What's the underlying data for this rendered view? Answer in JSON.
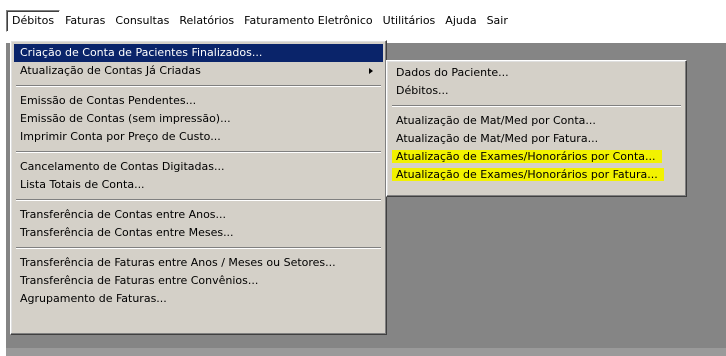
{
  "menubar": {
    "items": [
      "Débitos",
      "Faturas",
      "Consultas",
      "Relatórios",
      "Faturamento Eletrônico",
      "Utilitários",
      "Ajuda",
      "Sair"
    ]
  },
  "main_menu": {
    "items": [
      "Criação de Conta de Pacientes Finalizados...",
      "Atualização de Contas Já Criadas",
      "Emissão de Contas Pendentes...",
      "Emissão de Contas (sem impressão)...",
      "Imprimir Conta por Preço de Custo...",
      "Cancelamento de Contas Digitadas...",
      "Lista Totais de Conta...",
      "Transferência de Contas entre Anos...",
      "Transferência de Contas entre Meses...",
      "Transferência de Faturas entre Anos / Meses ou Setores...",
      "Transferência de Faturas entre Convênios...",
      "Agrupamento de Faturas..."
    ]
  },
  "sub_menu": {
    "items": [
      "Dados do Paciente...",
      "Débitos...",
      "Atualização de Mat/Med por Conta...",
      "Atualização de Mat/Med por Fatura...",
      "Atualização de Exames/Honorários por Conta...",
      "Atualização de Exames/Honorários por Fatura..."
    ]
  },
  "colors": {
    "workspace": "#858585",
    "menu_face": "#d4d0c8",
    "selection": "#0a246a",
    "highlight_marker": "#f2f200"
  }
}
